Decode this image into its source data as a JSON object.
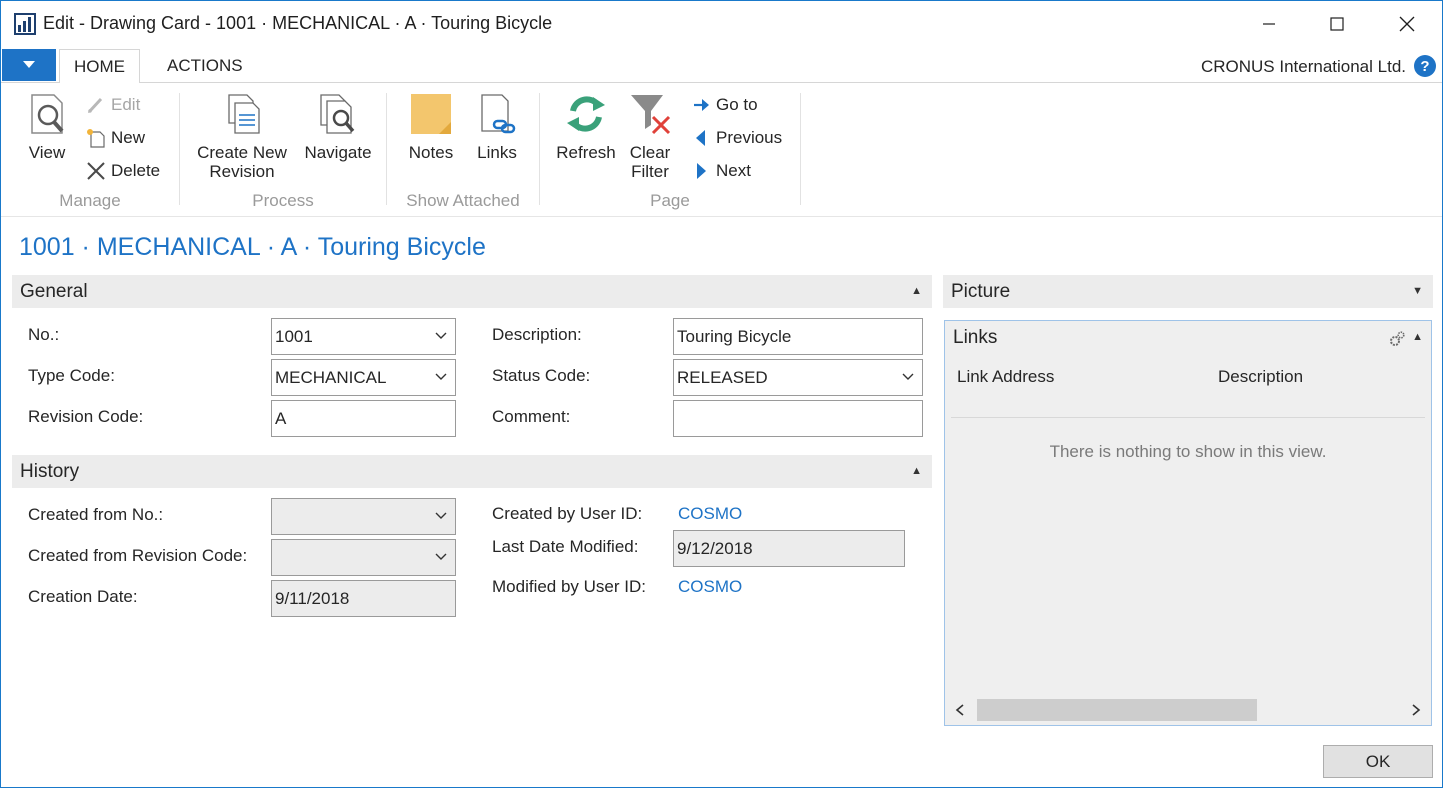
{
  "window": {
    "title": "Edit - Drawing Card - 1001 · MECHANICAL · A · Touring Bicycle"
  },
  "tabs": {
    "home": "HOME",
    "actions": "ACTIONS",
    "company": "CRONUS International Ltd."
  },
  "ribbon": {
    "manage": {
      "label": "Manage",
      "view": "View",
      "edit": "Edit",
      "new": "New",
      "delete": "Delete"
    },
    "process": {
      "label": "Process",
      "create_new_revision_line1": "Create New",
      "create_new_revision_line2": "Revision",
      "navigate": "Navigate"
    },
    "show_attached": {
      "label": "Show Attached",
      "notes": "Notes",
      "links": "Links"
    },
    "page": {
      "label": "Page",
      "refresh": "Refresh",
      "clear_filter_line1": "Clear",
      "clear_filter_line2": "Filter",
      "go_to": "Go to",
      "previous": "Previous",
      "next": "Next"
    }
  },
  "page_title": "1001 · MECHANICAL · A · Touring Bicycle",
  "general": {
    "header": "General",
    "no_label": "No.:",
    "no_value": "1001",
    "type_code_label": "Type Code:",
    "type_code_value": "MECHANICAL",
    "revision_code_label": "Revision Code:",
    "revision_code_value": "A",
    "description_label": "Description:",
    "description_value": "Touring Bicycle",
    "status_code_label": "Status Code:",
    "status_code_value": "RELEASED",
    "comment_label": "Comment:",
    "comment_value": ""
  },
  "history": {
    "header": "History",
    "created_from_no_label": "Created from No.:",
    "created_from_no_value": "",
    "created_from_rev_label": "Created from Revision Code:",
    "created_from_rev_value": "",
    "creation_date_label": "Creation Date:",
    "creation_date_value": "9/11/2018",
    "created_by_label": "Created by User ID:",
    "created_by_value": "COSMO",
    "last_modified_label": "Last Date Modified:",
    "last_modified_value": "9/12/2018",
    "modified_by_label": "Modified by User ID:",
    "modified_by_value": "COSMO"
  },
  "factbox": {
    "picture_header": "Picture",
    "links_header": "Links",
    "col_link_address": "Link Address",
    "col_description": "Description",
    "empty_message": "There is nothing to show in this view."
  },
  "footer": {
    "ok": "OK"
  },
  "colors": {
    "accent": "#1e73c6",
    "header_bg": "#ececec"
  }
}
